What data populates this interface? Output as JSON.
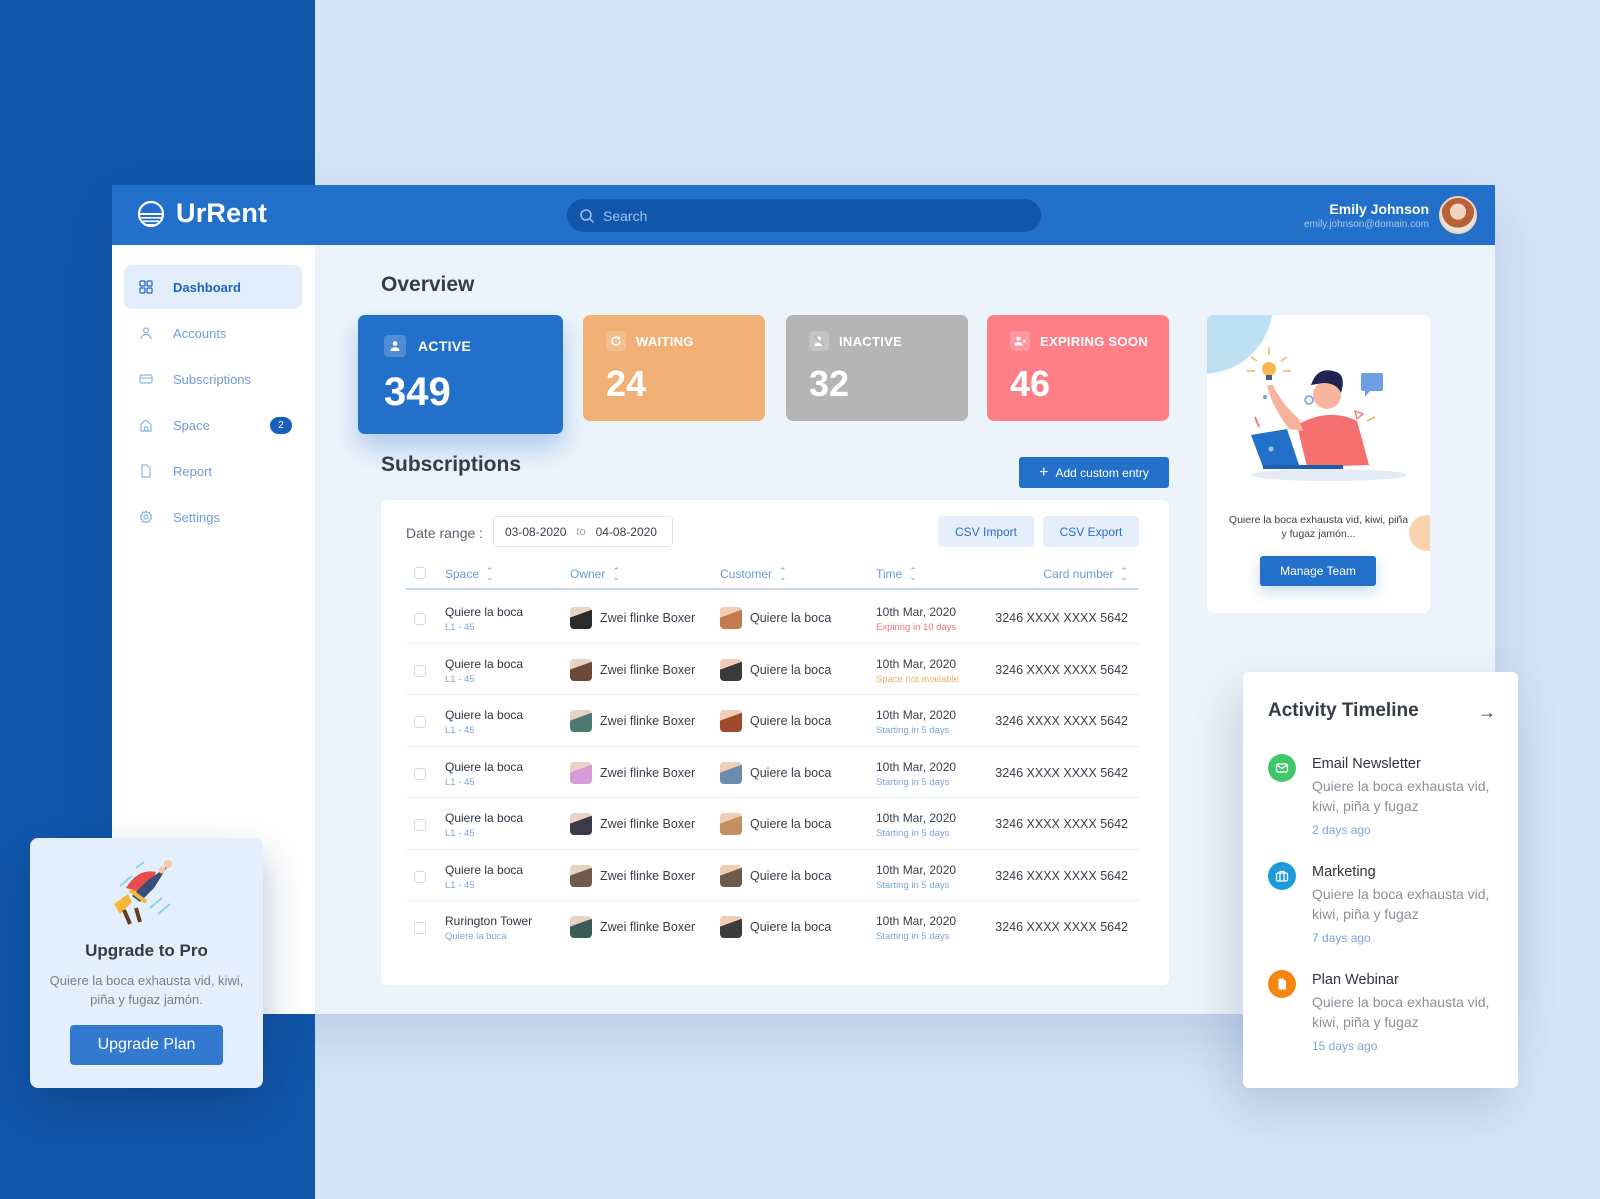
{
  "app": {
    "name": "UrRent",
    "search_placeholder": "Search",
    "user": {
      "name": "Emily Johnson",
      "email": "emily.johnson@domain.com"
    }
  },
  "sidebar": {
    "items": [
      {
        "label": "Dashboard",
        "icon": "grid-icon",
        "active": true
      },
      {
        "label": "Accounts",
        "icon": "user-icon"
      },
      {
        "label": "Subscriptions",
        "icon": "card-icon"
      },
      {
        "label": "Space",
        "icon": "home-icon",
        "badge": "2"
      },
      {
        "label": "Report",
        "icon": "file-icon"
      },
      {
        "label": "Settings",
        "icon": "gear-icon"
      }
    ]
  },
  "overview": {
    "title": "Overview",
    "stats": [
      {
        "label": "ACTIVE",
        "value": "349",
        "icon": "user-icon",
        "color": "#2270c9"
      },
      {
        "label": "WAITING",
        "value": "24",
        "icon": "refresh-icon",
        "color": "#f0b076"
      },
      {
        "label": "INACTIVE",
        "value": "32",
        "icon": "user-off-icon",
        "color": "#b5b5b5"
      },
      {
        "label": "EXPIRING SOON",
        "value": "46",
        "icon": "user-x-icon",
        "color": "#ff7f89"
      }
    ]
  },
  "subscriptions": {
    "title": "Subscriptions",
    "add_label": "Add custom entry",
    "date_range_label": "Date range :",
    "date_from": "03-08-2020",
    "date_to_sep": "to",
    "date_to": "04-08-2020",
    "csv_import": "CSV Import",
    "csv_export": "CSV Export",
    "columns": [
      "Space",
      "Owner",
      "Customer",
      "Time",
      "Card number"
    ],
    "rows": [
      {
        "space": "Quiere la boca",
        "space_sub": "L1 - 45",
        "owner": "Zwei flinke Boxer",
        "customer": "Quiere la boca",
        "date": "10th Mar, 2020",
        "status": "Expiring in 10 days",
        "status_color": "#f2707c",
        "card": "3246 XXXX XXXX 5642"
      },
      {
        "space": "Quiere la boca",
        "space_sub": "L1 - 45",
        "owner": "Zwei flinke Boxer",
        "customer": "Quiere la boca",
        "date": "10th Mar, 2020",
        "status": "Space not available",
        "status_color": "#f4ad68",
        "card": "3246 XXXX XXXX 5642"
      },
      {
        "space": "Quiere la boca",
        "space_sub": "L1 - 45",
        "owner": "Zwei flinke Boxer",
        "customer": "Quiere la boca",
        "date": "10th Mar, 2020",
        "status": "Starting in 5 days",
        "status_color": "#7ba5dc",
        "card": "3246 XXXX XXXX 5642"
      },
      {
        "space": "Quiere la boca",
        "space_sub": "L1 - 45",
        "owner": "Zwei flinke Boxer",
        "customer": "Quiere la boca",
        "date": "10th Mar, 2020",
        "status": "Starting in 5 days",
        "status_color": "#7ba5dc",
        "card": "3246 XXXX XXXX 5642"
      },
      {
        "space": "Quiere la boca",
        "space_sub": "L1 - 45",
        "owner": "Zwei flinke Boxer",
        "customer": "Quiere la boca",
        "date": "10th Mar, 2020",
        "status": "Starting in 5 days",
        "status_color": "#7ba5dc",
        "card": "3246 XXXX XXXX 5642"
      },
      {
        "space": "Quiere la boca",
        "space_sub": "L1 - 45",
        "owner": "Zwei flinke Boxer",
        "customer": "Quiere la boca",
        "date": "10th Mar, 2020",
        "status": "Starting in 5 days",
        "status_color": "#7ba5dc",
        "card": "3246 XXXX XXXX 5642"
      },
      {
        "space": "Rurington Tower",
        "space_sub": "Quiere la boca",
        "owner": "Zwei flinke Boxer",
        "customer": "Quiere la boca",
        "date": "10th Mar, 2020",
        "status": "Starting in 5 days",
        "status_color": "#7ba5dc",
        "card": "3246 XXXX XXXX 5642"
      }
    ]
  },
  "team_card": {
    "text": "Quiere la boca exhausta vid, kiwi, piña y fugaz jamón...",
    "button": "Manage Team"
  },
  "activity": {
    "title": "Activity Timeline",
    "items": [
      {
        "title": "Email Newsletter",
        "desc": "Quiere la boca exhausta vid, kiwi, piña y fugaz",
        "time": "2 days ago",
        "icon": "mail-icon",
        "color": "#3fc76a"
      },
      {
        "title": "Marketing",
        "desc": "Quiere la boca exhausta vid, kiwi, piña y fugaz",
        "time": "7 days ago",
        "icon": "briefcase-icon",
        "color": "#1f9ad8"
      },
      {
        "title": "Plan Webinar",
        "desc": "Quiere la boca exhausta vid, kiwi, piña y fugaz",
        "time": "15 days ago",
        "icon": "file-icon",
        "color": "#f7860c"
      }
    ]
  },
  "upgrade": {
    "title": "Upgrade to Pro",
    "desc": "Quiere la boca exhausta vid, kiwi, piña y fugaz jamón.",
    "button": "Upgrade Plan"
  }
}
